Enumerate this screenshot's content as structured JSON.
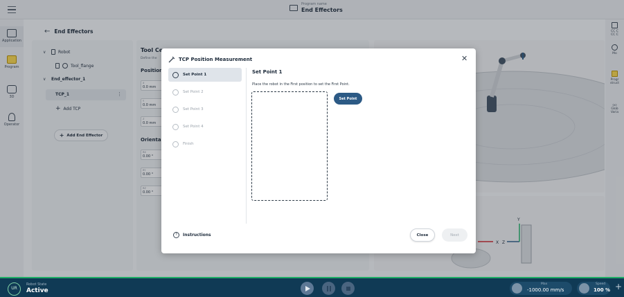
{
  "topbar": {
    "program_label": "Program name",
    "program_name": "End Effectors"
  },
  "left_rail": [
    {
      "label": "Application",
      "icon": "grid-icon"
    },
    {
      "label": "Program",
      "icon": "program-icon"
    },
    {
      "label": "3D",
      "icon": "cube-icon"
    },
    {
      "label": "Operator",
      "icon": "person-icon"
    }
  ],
  "right_rail": [
    {
      "label": "CC C\nCC C",
      "icon": "code-icon"
    },
    {
      "label": "Mo",
      "icon": "move-icon"
    },
    {
      "label": "Progr\nstruct",
      "icon": "program-structure-icon"
    },
    {
      "label": "(x)\nGlob\nVaria",
      "icon": "variable-icon"
    }
  ],
  "page": {
    "back_title": "End Effectors",
    "tree": {
      "robot": "Robot",
      "tool_flange": "Tool_flange",
      "end_effector": "End_effector_1",
      "tcp": "TCP_1",
      "add_tcp": "Add TCP",
      "add_end_effector": "Add End Effector"
    },
    "tcp_panel": {
      "title": "Tool Ce",
      "subtitle": "Define the",
      "position": "Position",
      "orientation": "Orienta",
      "fields_pos": [
        {
          "label": "X",
          "value": "0.0 mm"
        },
        {
          "label": "Y",
          "value": "0.0 mm"
        },
        {
          "label": "Z",
          "value": "0.0 mm"
        }
      ],
      "fields_rot": [
        {
          "label": "RX",
          "value": "0.00 °"
        },
        {
          "label": "RY",
          "value": "0.00 °"
        },
        {
          "label": "RZ",
          "value": "0.00 °"
        }
      ]
    },
    "axes": {
      "x_label": "X",
      "z_label": "Z",
      "y_label": "Y"
    }
  },
  "modal": {
    "title": "TCP Position Measurement",
    "steps": [
      "Set Point 1",
      "Set Point 2",
      "Set Point 3",
      "Set Point 4",
      "Finish"
    ],
    "active_step": 0,
    "heading": "Set Point 1",
    "description": "Place the robot in the First position to set the First Point.",
    "set_point_label": "Set Point",
    "instructions_label": "Instructions",
    "close_label": "Close",
    "next_label": "Next"
  },
  "bottom": {
    "logo": "UR",
    "robot_state_label": "Robot State",
    "robot_state": "Active",
    "max_label": "Max",
    "max_value": "-1000.00 mm/s",
    "speed_label": "Speed",
    "speed_value": "100 %"
  },
  "colors": {
    "accent": "#2c5a85",
    "status_green": "#1fae67",
    "bottom_bar": "#103a55",
    "highlight_yellow": "#f3d24c"
  }
}
